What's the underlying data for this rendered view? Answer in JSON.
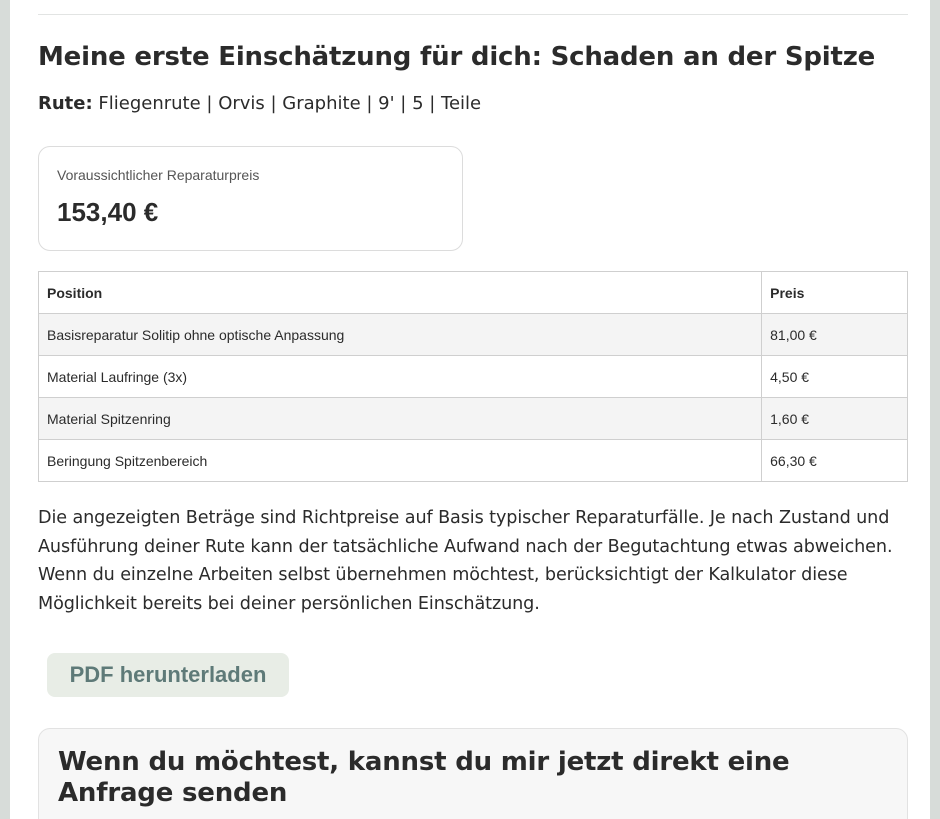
{
  "estimate": {
    "title": "Meine erste Einschätzung für dich: Schaden an der Spitze",
    "rute_label": "Rute:",
    "rute_value": " Fliegenrute | Orvis | Graphite | 9' | 5 | Teile"
  },
  "price_box": {
    "label": "Voraussichtlicher Reparaturpreis",
    "value": "153,40 €"
  },
  "table": {
    "headers": [
      "Position",
      "Preis"
    ],
    "rows": [
      {
        "position": "Basisreparatur Solitip ohne optische Anpassung",
        "price": "81,00 €"
      },
      {
        "position": "Material Laufringe (3x)",
        "price": "4,50 €"
      },
      {
        "position": "Material Spitzenring",
        "price": "1,60 €"
      },
      {
        "position": "Beringung Spitzenbereich",
        "price": "66,30 €"
      }
    ]
  },
  "note": "Die angezeigten Beträge sind Richtpreise auf Basis typischer Reparaturfälle. Je nach Zustand und Ausführung deiner Rute kann der tatsächliche Aufwand nach der Begutachtung etwas abweichen. Wenn du einzelne Arbeiten selbst übernehmen möchtest, berücksichtigt der Kalkulator diese Möglichkeit bereits bei deiner persönlichen Einschätzung.",
  "actions": {
    "pdf_label": "PDF herunterladen"
  },
  "inquiry": {
    "heading": "Wenn du möchtest, kannst du mir jetzt direkt eine Anfrage senden"
  }
}
